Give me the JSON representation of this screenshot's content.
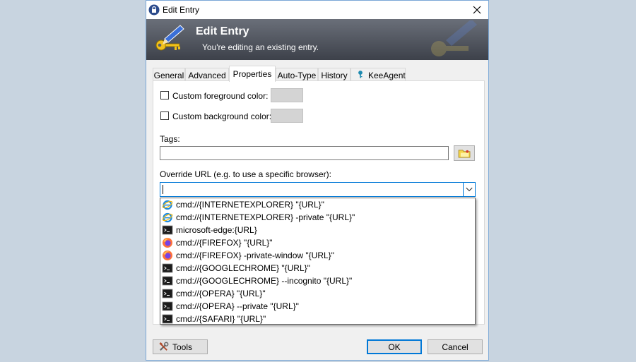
{
  "window": {
    "title": "Edit Entry"
  },
  "banner": {
    "title": "Edit Entry",
    "subtitle": "You're editing an existing entry."
  },
  "tabs": [
    {
      "label": "General"
    },
    {
      "label": "Advanced"
    },
    {
      "label": "Properties",
      "active": true
    },
    {
      "label": "Auto-Type"
    },
    {
      "label": "History"
    },
    {
      "label": "KeeAgent"
    }
  ],
  "properties": {
    "fg_label": "Custom foreground color:",
    "bg_label": "Custom background color:",
    "tags_label": "Tags:",
    "tags_value": "",
    "override_label": "Override URL (e.g. to use a specific browser):",
    "override_value": ""
  },
  "override_options": [
    {
      "text": "cmd://{INTERNETEXPLORER} \"{URL}\"",
      "icon": "ie-icon"
    },
    {
      "text": "cmd://{INTERNETEXPLORER} -private \"{URL}\"",
      "icon": "ie-icon"
    },
    {
      "text": "microsoft-edge:{URL}",
      "icon": "terminal-icon"
    },
    {
      "text": "cmd://{FIREFOX} \"{URL}\"",
      "icon": "firefox-icon"
    },
    {
      "text": "cmd://{FIREFOX} -private-window \"{URL}\"",
      "icon": "firefox-icon"
    },
    {
      "text": "cmd://{GOOGLECHROME} \"{URL}\"",
      "icon": "terminal-icon"
    },
    {
      "text": "cmd://{GOOGLECHROME} --incognito \"{URL}\"",
      "icon": "terminal-icon"
    },
    {
      "text": "cmd://{OPERA} \"{URL}\"",
      "icon": "terminal-icon"
    },
    {
      "text": "cmd://{OPERA} --private \"{URL}\"",
      "icon": "terminal-icon"
    },
    {
      "text": "cmd://{SAFARI} \"{URL}\"",
      "icon": "terminal-icon"
    }
  ],
  "footer": {
    "tools_label": "Tools",
    "ok_label": "OK",
    "cancel_label": "Cancel"
  },
  "colors": {
    "banner_dark": "#3d414a",
    "accent": "#0078d7",
    "window_bg": "#f0f0f0"
  }
}
